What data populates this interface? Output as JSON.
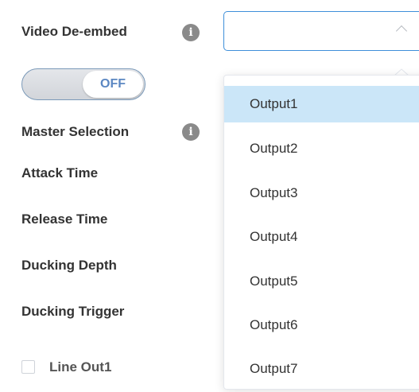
{
  "form": {
    "video_deembed_label": "Video De-embed",
    "toggle_state": "OFF",
    "master_selection_label": "Master Selection",
    "attack_time_label": "Attack Time",
    "release_time_label": "Release Time",
    "ducking_depth_label": "Ducking Depth",
    "ducking_trigger_label": "Ducking Trigger",
    "line_out_label": "Line Out1",
    "info_icon_glyph": "i"
  },
  "select": {
    "value": "",
    "state": "open"
  },
  "dropdown": {
    "options": [
      {
        "label": "Output1",
        "highlighted": true
      },
      {
        "label": "Output2",
        "highlighted": false
      },
      {
        "label": "Output3",
        "highlighted": false
      },
      {
        "label": "Output4",
        "highlighted": false
      },
      {
        "label": "Output5",
        "highlighted": false
      },
      {
        "label": "Output6",
        "highlighted": false
      },
      {
        "label": "Output7",
        "highlighted": false
      }
    ]
  },
  "colors": {
    "accent": "#3f8fd9",
    "highlight": "#cbe6f8",
    "toggle_text": "#5b87c2",
    "label_text": "#333333"
  }
}
